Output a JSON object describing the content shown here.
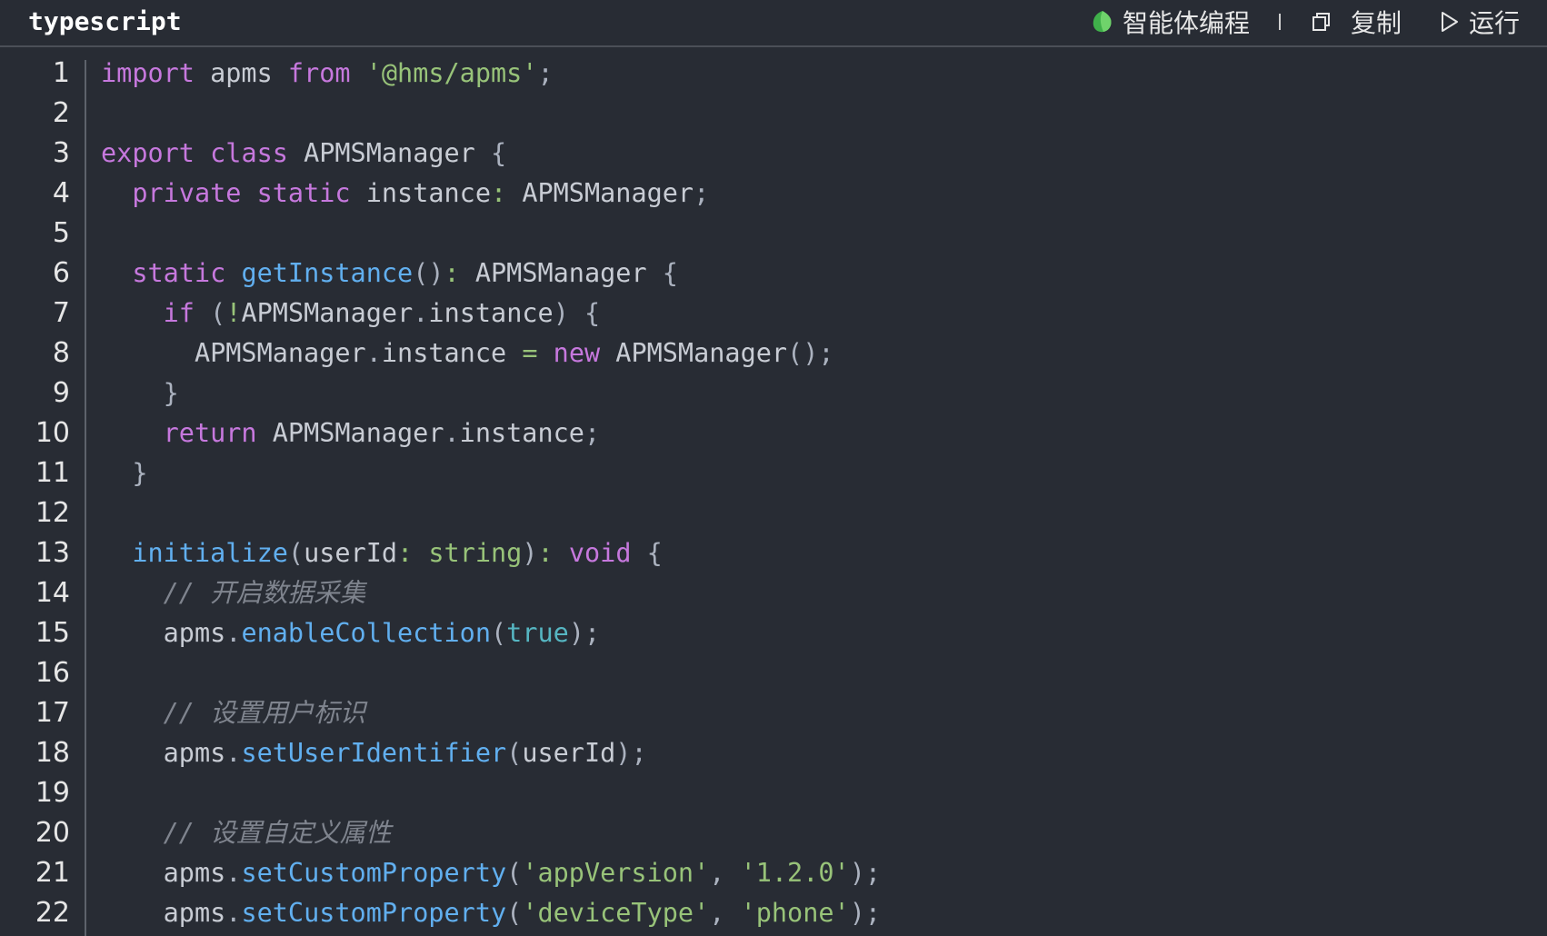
{
  "header": {
    "language": "typescript",
    "agent_label": "智能体编程",
    "copy_label": "复制",
    "run_label": "运行"
  },
  "colors": {
    "background": "#282c34",
    "keyword": "#c678dd",
    "string": "#98c379",
    "function": "#61afef",
    "literal": "#56b6c2",
    "comment": "#7f848e",
    "text": "#c8ccd4"
  },
  "icons": {
    "agent": "agent-leaf-icon",
    "copy": "copy-icon",
    "run": "play-icon"
  },
  "code": [
    {
      "n": "1",
      "tokens": [
        [
          "keyword",
          "import"
        ],
        [
          "plain",
          " apms "
        ],
        [
          "keyword",
          "from"
        ],
        [
          "plain",
          " "
        ],
        [
          "string",
          "'@hms/apms'"
        ],
        [
          "punct",
          ";"
        ]
      ]
    },
    {
      "n": "2",
      "tokens": []
    },
    {
      "n": "3",
      "tokens": [
        [
          "keyword",
          "export"
        ],
        [
          "plain",
          " "
        ],
        [
          "keyword",
          "class"
        ],
        [
          "plain",
          " APMSManager "
        ],
        [
          "punct",
          "{"
        ]
      ]
    },
    {
      "n": "4",
      "tokens": [
        [
          "plain",
          "  "
        ],
        [
          "keyword",
          "private"
        ],
        [
          "plain",
          " "
        ],
        [
          "keyword",
          "static"
        ],
        [
          "plain",
          " instance"
        ],
        [
          "operator",
          ":"
        ],
        [
          "plain",
          " APMSManager"
        ],
        [
          "punct",
          ";"
        ]
      ]
    },
    {
      "n": "5",
      "tokens": []
    },
    {
      "n": "6",
      "tokens": [
        [
          "plain",
          "  "
        ],
        [
          "keyword",
          "static"
        ],
        [
          "plain",
          " "
        ],
        [
          "function",
          "getInstance"
        ],
        [
          "punct",
          "()"
        ],
        [
          "operator",
          ":"
        ],
        [
          "plain",
          " APMSManager "
        ],
        [
          "punct",
          "{"
        ]
      ]
    },
    {
      "n": "7",
      "tokens": [
        [
          "plain",
          "    "
        ],
        [
          "keyword",
          "if"
        ],
        [
          "plain",
          " "
        ],
        [
          "punct",
          "("
        ],
        [
          "operator",
          "!"
        ],
        [
          "plain",
          "APMSManager"
        ],
        [
          "punct",
          "."
        ],
        [
          "plain",
          "instance"
        ],
        [
          "punct",
          ")"
        ],
        [
          "plain",
          " "
        ],
        [
          "punct",
          "{"
        ]
      ]
    },
    {
      "n": "8",
      "tokens": [
        [
          "plain",
          "      APMSManager"
        ],
        [
          "punct",
          "."
        ],
        [
          "plain",
          "instance "
        ],
        [
          "operator",
          "="
        ],
        [
          "plain",
          " "
        ],
        [
          "keyword",
          "new"
        ],
        [
          "plain",
          " APMSManager"
        ],
        [
          "punct",
          "();"
        ]
      ]
    },
    {
      "n": "9",
      "tokens": [
        [
          "plain",
          "    "
        ],
        [
          "punct",
          "}"
        ]
      ]
    },
    {
      "n": "10",
      "tokens": [
        [
          "plain",
          "    "
        ],
        [
          "keyword",
          "return"
        ],
        [
          "plain",
          " APMSManager"
        ],
        [
          "punct",
          "."
        ],
        [
          "plain",
          "instance"
        ],
        [
          "punct",
          ";"
        ]
      ]
    },
    {
      "n": "11",
      "tokens": [
        [
          "plain",
          "  "
        ],
        [
          "punct",
          "}"
        ]
      ]
    },
    {
      "n": "12",
      "tokens": []
    },
    {
      "n": "13",
      "tokens": [
        [
          "plain",
          "  "
        ],
        [
          "function",
          "initialize"
        ],
        [
          "punct",
          "("
        ],
        [
          "plain",
          "userId"
        ],
        [
          "operator",
          ":"
        ],
        [
          "plain",
          " "
        ],
        [
          "type",
          "string"
        ],
        [
          "punct",
          ")"
        ],
        [
          "operator",
          ":"
        ],
        [
          "plain",
          " "
        ],
        [
          "keyword",
          "void"
        ],
        [
          "plain",
          " "
        ],
        [
          "punct",
          "{"
        ]
      ]
    },
    {
      "n": "14",
      "tokens": [
        [
          "plain",
          "    "
        ],
        [
          "comment",
          "// 开启数据采集"
        ]
      ]
    },
    {
      "n": "15",
      "tokens": [
        [
          "plain",
          "    apms"
        ],
        [
          "punct",
          "."
        ],
        [
          "function",
          "enableCollection"
        ],
        [
          "punct",
          "("
        ],
        [
          "literal",
          "true"
        ],
        [
          "punct",
          ");"
        ]
      ]
    },
    {
      "n": "16",
      "tokens": []
    },
    {
      "n": "17",
      "tokens": [
        [
          "plain",
          "    "
        ],
        [
          "comment",
          "// 设置用户标识"
        ]
      ]
    },
    {
      "n": "18",
      "tokens": [
        [
          "plain",
          "    apms"
        ],
        [
          "punct",
          "."
        ],
        [
          "function",
          "setUserIdentifier"
        ],
        [
          "punct",
          "("
        ],
        [
          "plain",
          "userId"
        ],
        [
          "punct",
          ");"
        ]
      ]
    },
    {
      "n": "19",
      "tokens": []
    },
    {
      "n": "20",
      "tokens": [
        [
          "plain",
          "    "
        ],
        [
          "comment",
          "// 设置自定义属性"
        ]
      ]
    },
    {
      "n": "21",
      "tokens": [
        [
          "plain",
          "    apms"
        ],
        [
          "punct",
          "."
        ],
        [
          "function",
          "setCustomProperty"
        ],
        [
          "punct",
          "("
        ],
        [
          "string",
          "'appVersion'"
        ],
        [
          "punct",
          ","
        ],
        [
          "plain",
          " "
        ],
        [
          "string",
          "'1.2.0'"
        ],
        [
          "punct",
          ");"
        ]
      ]
    },
    {
      "n": "22",
      "tokens": [
        [
          "plain",
          "    apms"
        ],
        [
          "punct",
          "."
        ],
        [
          "function",
          "setCustomProperty"
        ],
        [
          "punct",
          "("
        ],
        [
          "string",
          "'deviceType'"
        ],
        [
          "punct",
          ","
        ],
        [
          "plain",
          " "
        ],
        [
          "string",
          "'phone'"
        ],
        [
          "punct",
          ");"
        ]
      ]
    }
  ]
}
